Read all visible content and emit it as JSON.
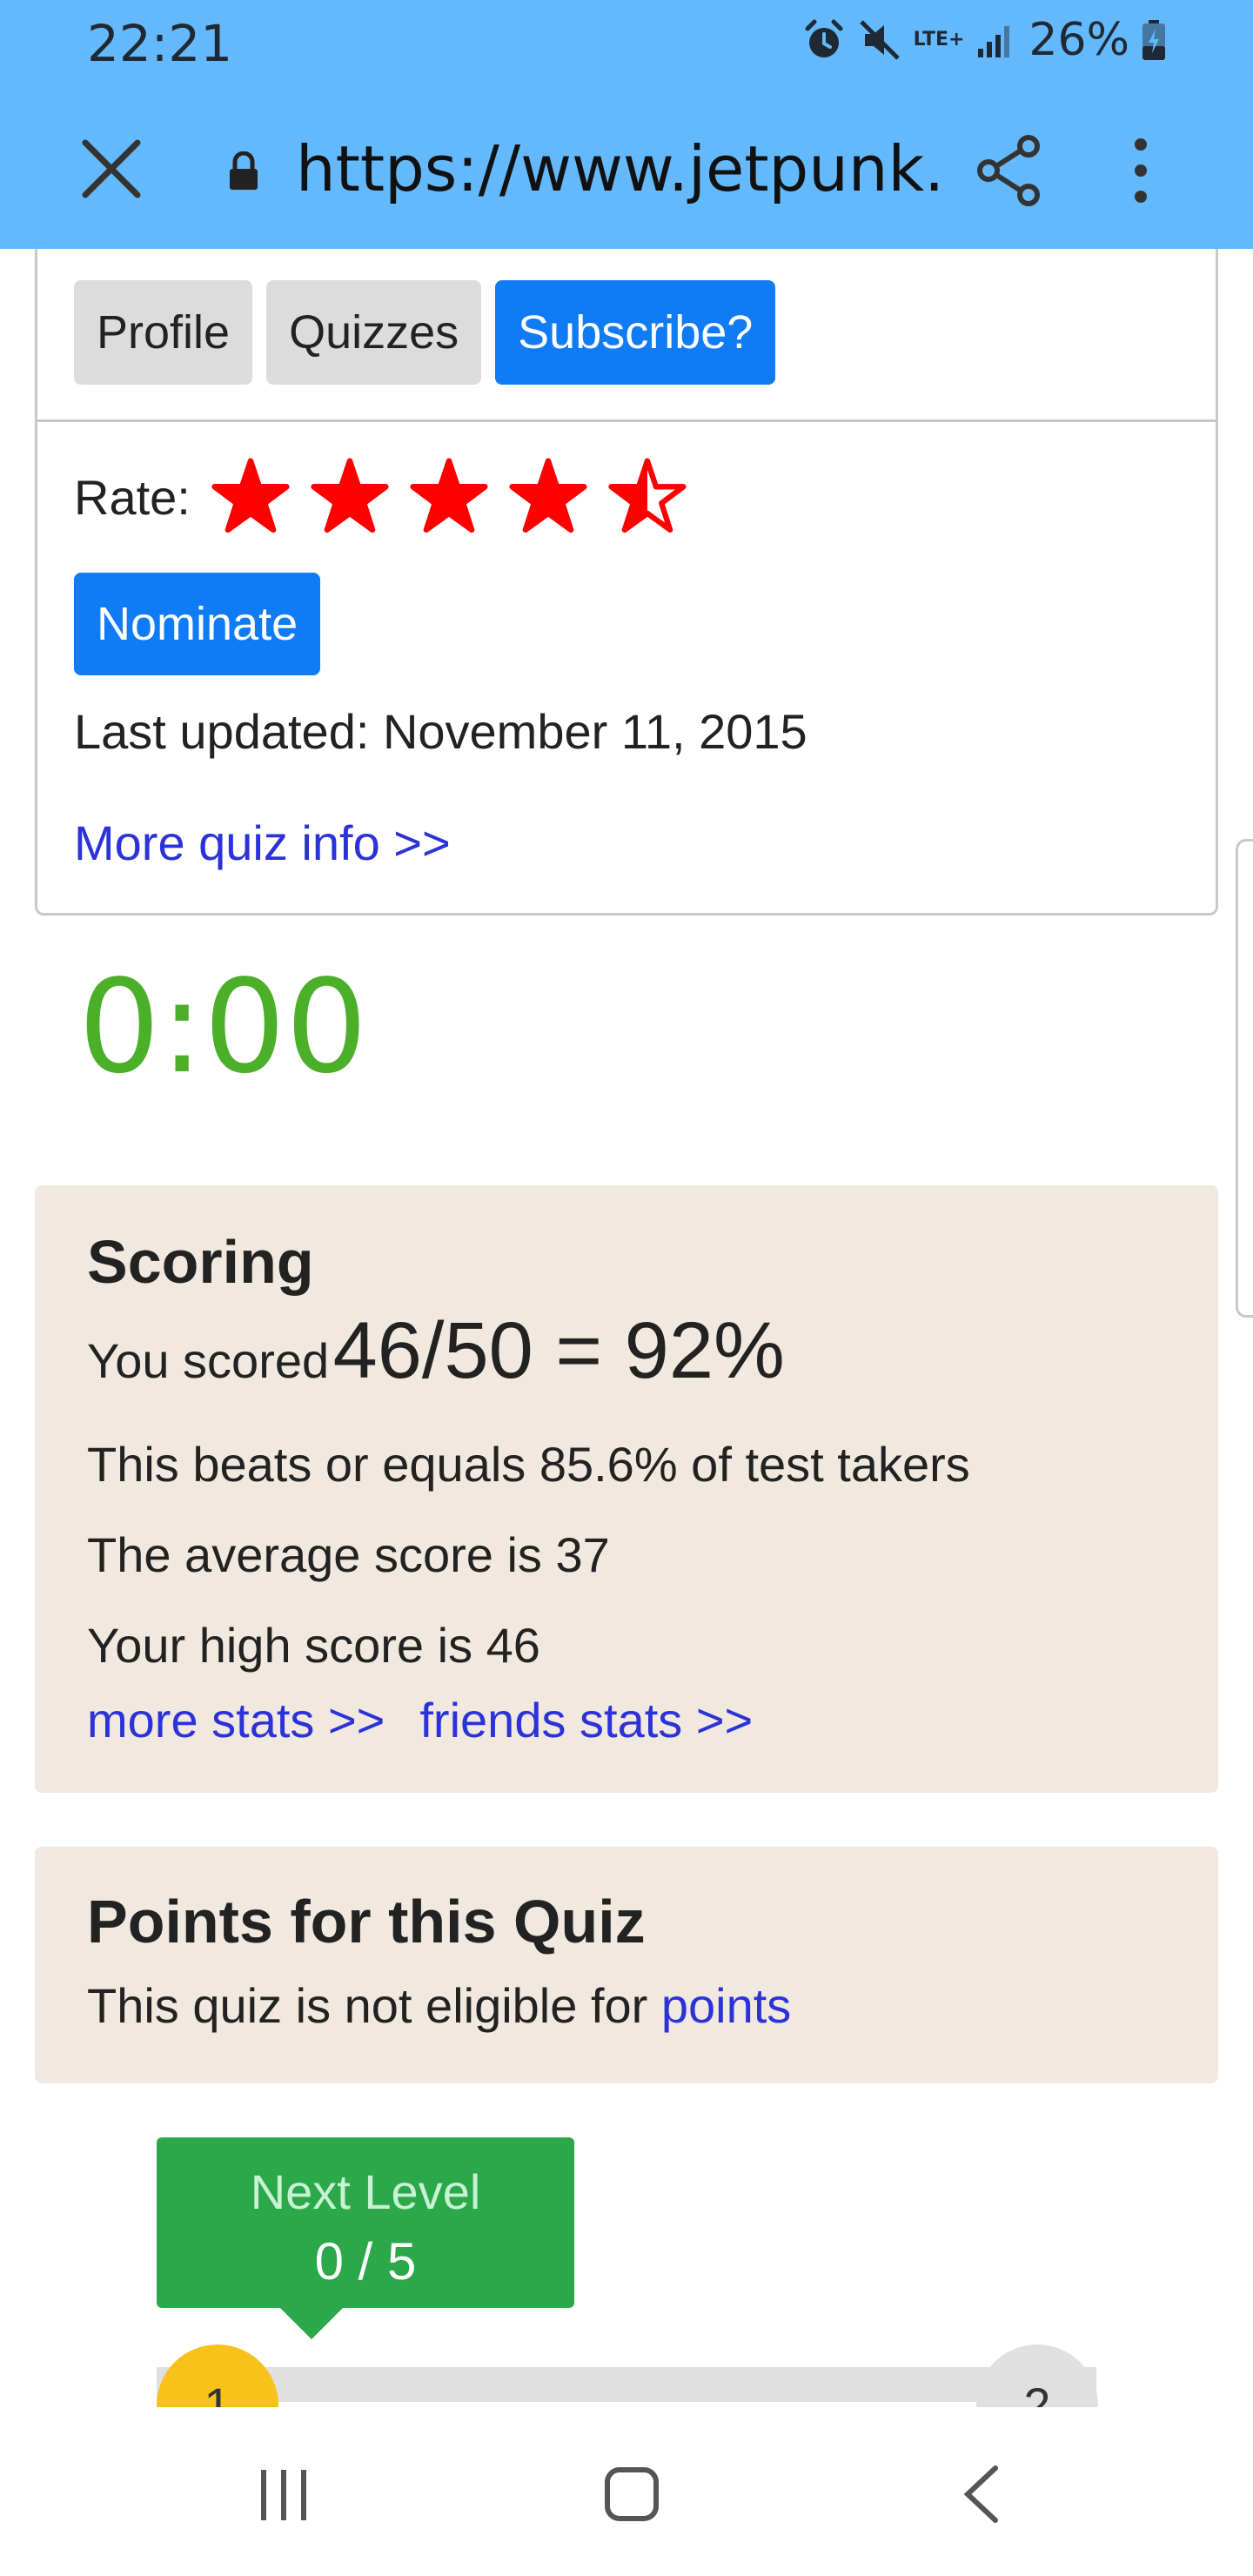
{
  "status_bar": {
    "time": "22:21",
    "network": "LTE+",
    "battery": "26%",
    "icons": [
      "alarm-icon",
      "mute-icon",
      "lte-icon",
      "signal-icon",
      "battery-icon"
    ]
  },
  "browser": {
    "url": "https://www.jetpunk.co...",
    "icons": [
      "close-icon",
      "lock-icon",
      "share-icon",
      "more-vert-icon"
    ]
  },
  "info_card": {
    "buttons": {
      "profile": "Profile",
      "quizzes": "Quizzes",
      "subscribe": "Subscribe?"
    },
    "rate_label": "Rate:",
    "rating": 4.5,
    "rating_max": 5,
    "star_color": "#ff0000",
    "nominate_label": "Nominate",
    "last_updated": "Last updated: November 11, 2015",
    "more_info": "More quiz info >>"
  },
  "timer": "0:00",
  "scoring": {
    "title": "Scoring",
    "you_scored": "You scored",
    "score": "46/50 = 92%",
    "beats": "This beats or equals 85.6% of test takers",
    "average": "The average score is 37",
    "high_score": "Your high score is 46",
    "more_stats": "more stats >>",
    "friends_stats": "friends stats >>"
  },
  "points": {
    "title": "Points for this Quiz",
    "text": "This quiz is not eligible for",
    "link": "points"
  },
  "level": {
    "label": "Next Level",
    "progress": "0 / 5",
    "current": "1",
    "next": "2"
  },
  "nav": {
    "icons": [
      "recent-apps-icon",
      "home-icon",
      "back-icon"
    ]
  },
  "colors": {
    "bar_blue": "#64b9fc",
    "button_blue": "#0f7bf4",
    "link_blue": "#2b32d8",
    "timer_green": "#4caf2a",
    "panel_beige": "#f1e8df",
    "level_green": "#2aa84a",
    "level_yellow": "#f9c21a"
  }
}
